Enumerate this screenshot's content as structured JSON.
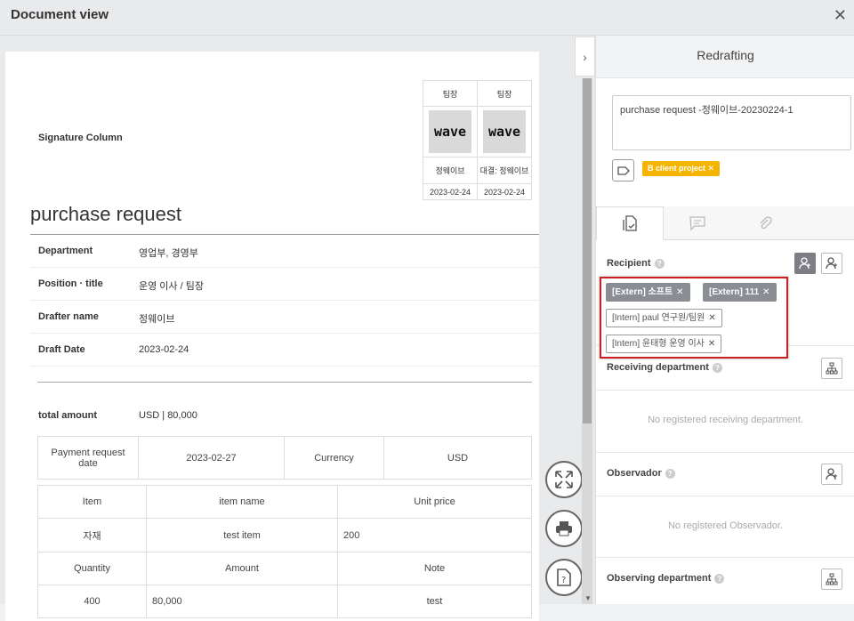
{
  "window": {
    "title": "Document view",
    "close_icon": "close-icon"
  },
  "document": {
    "signature": {
      "label": "Signature Column",
      "columns": [
        {
          "role": "팀장",
          "stamp": "wave",
          "name": "정웨이브",
          "date": "2023-02-24"
        },
        {
          "role": "팀장",
          "stamp": "wave",
          "name": "대결: 정웨이브",
          "date": "2023-02-24"
        }
      ]
    },
    "title": "purchase request",
    "fields": [
      {
        "key": "Department",
        "value": "영업부, 경영부"
      },
      {
        "key": "Position · title",
        "value": "운영 이사 / 팀장"
      },
      {
        "key": "Drafter name",
        "value": "정웨이브"
      },
      {
        "key": "Draft Date",
        "value": "2023-02-24"
      }
    ],
    "total": {
      "key": "total amount",
      "value": "USD | 80,000"
    },
    "payment": {
      "label": "Payment request date",
      "date": "2023-02-27",
      "currency_label": "Currency",
      "currency": "USD"
    },
    "items": {
      "headers": [
        "Item",
        "item name",
        "Unit price"
      ],
      "row1": [
        "자재",
        "test item",
        "200"
      ],
      "headers2": [
        "Quantity",
        "Amount",
        "Note"
      ],
      "row2": [
        "400",
        "80,000",
        "test"
      ]
    }
  },
  "panel": {
    "title": "Redrafting",
    "subject": "purchase request -정웨이브-20230224-1",
    "tag": "B client project",
    "recipient": {
      "label": "Recipient",
      "chips": [
        "[Extern] 소프트",
        "[Extern] 111",
        "[Intern] paul 연구원/팀원",
        "[Intern] 윤태형 운영 이사"
      ]
    },
    "receiving": {
      "label": "Receiving department",
      "empty": "No registered receiving department."
    },
    "observer": {
      "label": "Observador",
      "empty": "No registered Observador."
    },
    "observing": {
      "label": "Observing department"
    }
  },
  "colors": {
    "tag": "#f5b400",
    "highlight": "#cc1f24",
    "ext_chip": "#8b8d94"
  }
}
